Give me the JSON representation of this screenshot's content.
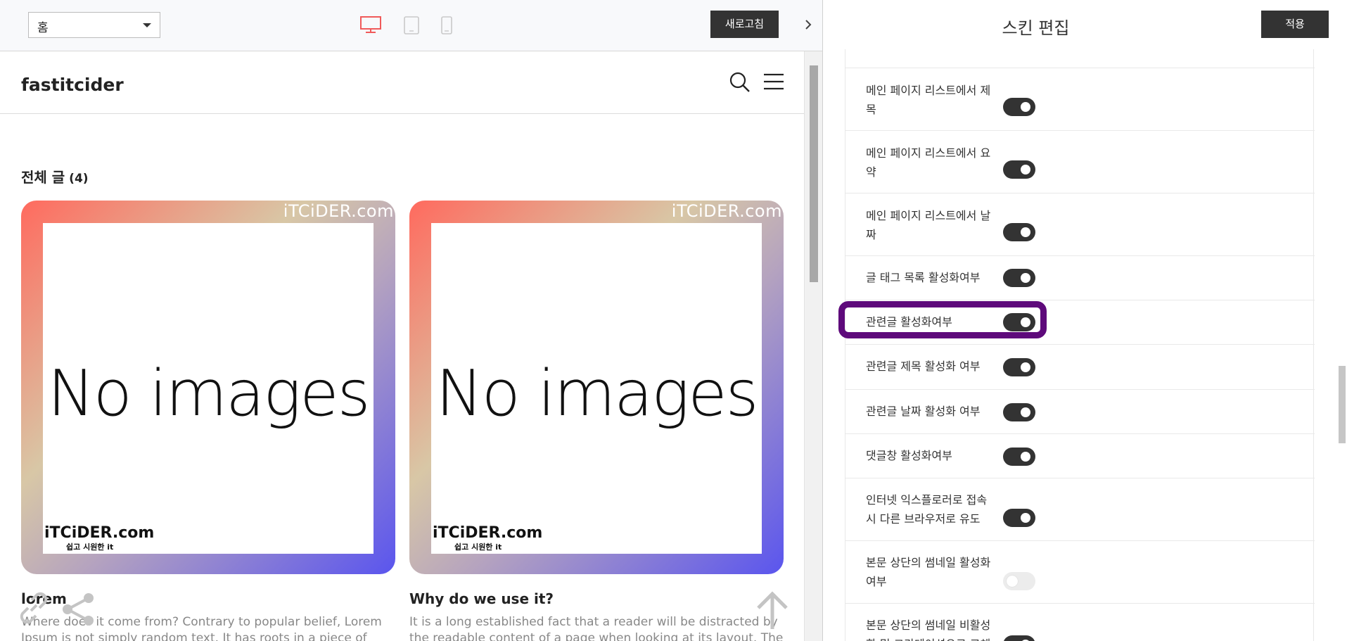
{
  "toolbar": {
    "page_select_value": "홈",
    "refresh_label": "새로고침"
  },
  "blog": {
    "title": "fastitcider",
    "section_title": "전체 글",
    "section_count": "(4)"
  },
  "posts": [
    {
      "thumb_text": "No images",
      "watermark_top": "iTCiDER.com",
      "watermark_logo": "iTCiDER.com",
      "watermark_sub": "쉽고 시원한 it",
      "title": "lorem",
      "excerpt_1": "Where does it come from? Contrary to popular belief, Lorem",
      "excerpt_2": "Ipsum is not simply random text. It has roots in a piece of"
    },
    {
      "thumb_text": "No images",
      "watermark_top": "iTCiDER.com",
      "watermark_logo": "iTCiDER.com",
      "watermark_sub": "쉽고 시원한 it",
      "title": "Why do we use it?",
      "excerpt_1": "It is a long established fact that a reader will be distracted by",
      "excerpt_2": "the readable content of a page when looking at its layout. The"
    }
  ],
  "editor": {
    "title": "스킨 편집",
    "apply_label": "적용",
    "options": [
      {
        "line1": "메인 페이지 리스트에서 제",
        "line2": "목",
        "on": true
      },
      {
        "line1": "메인 페이지 리스트에서 요",
        "line2": "약",
        "on": true
      },
      {
        "line1": "메인 페이지 리스트에서 날",
        "line2": "짜",
        "on": true
      },
      {
        "line1": "글 태그 목록 활성화여부",
        "line2": "",
        "on": true
      },
      {
        "line1": "관련글 활성화여부",
        "line2": "",
        "on": true
      },
      {
        "line1": "관련글 제목 활성화 여부",
        "line2": "",
        "on": true
      },
      {
        "line1": "관련글 날짜 활성화 여부",
        "line2": "",
        "on": true
      },
      {
        "line1": "댓글창 활성화여부",
        "line2": "",
        "on": true
      },
      {
        "line1": "인터넷 익스플로러로 접속",
        "line2": "시 다른 브라우저로 유도",
        "on": true
      },
      {
        "line1": "본문 상단의 썸네일 활성화",
        "line2": "여부",
        "on": false
      },
      {
        "line1": "본문 상단의 썸네일 비활성",
        "line2": "화 및 그라데이션으로 교체",
        "on": true
      }
    ]
  },
  "colors": {
    "dark_button": "#333333",
    "active_device": "#f05a5a",
    "highlight": "#5e0a7b",
    "gradient": [
      "#ff6a5e",
      "#d8c7a6",
      "#5a55ee"
    ]
  },
  "icons": [
    "desktop-icon",
    "tablet-icon",
    "mobile-icon",
    "chevron-right-icon",
    "search-icon",
    "menu-icon",
    "link-icon",
    "share-icon",
    "arrow-up-icon"
  ]
}
